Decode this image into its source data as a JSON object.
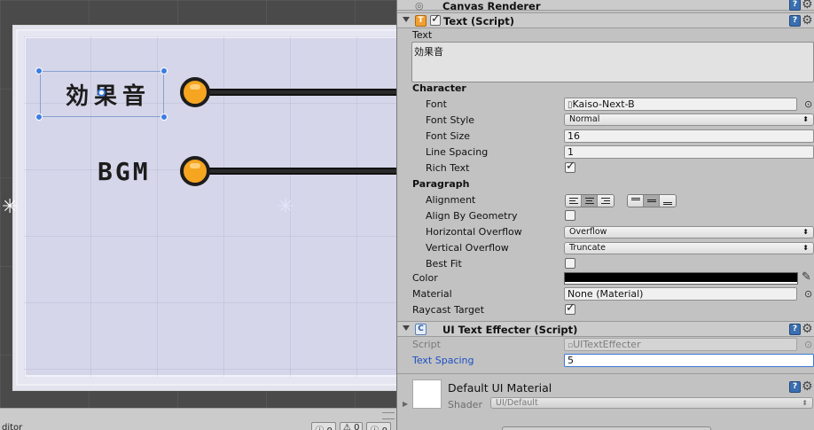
{
  "scene": {
    "label_effects": "効果音",
    "label_bgm": "BGM",
    "bottom_left_label": "ditor",
    "counter_a": "0",
    "counter_b": "0",
    "counter_c": "0"
  },
  "inspector": {
    "canvas_renderer_title": "Canvas Renderer",
    "text_component": {
      "title": "Text (Script)",
      "text_label": "Text",
      "text_value": "効果音",
      "character_heading": "Character",
      "font_label": "Font",
      "font_value": "Kaiso-Next-B",
      "font_style_label": "Font Style",
      "font_style_value": "Normal",
      "font_size_label": "Font Size",
      "font_size_value": "16",
      "line_spacing_label": "Line Spacing",
      "line_spacing_value": "1",
      "rich_text_label": "Rich Text",
      "rich_text_checked": true,
      "paragraph_heading": "Paragraph",
      "alignment_label": "Alignment",
      "align_by_geometry_label": "Align By Geometry",
      "horizontal_overflow_label": "Horizontal Overflow",
      "horizontal_overflow_value": "Overflow",
      "vertical_overflow_label": "Vertical Overflow",
      "vertical_overflow_value": "Truncate",
      "best_fit_label": "Best Fit",
      "color_label": "Color",
      "color_value": "#000000",
      "material_label": "Material",
      "material_value": "None (Material)",
      "raycast_target_label": "Raycast Target",
      "raycast_target_checked": true
    },
    "effecter_component": {
      "title": "UI Text Effecter (Script)",
      "script_label": "Script",
      "script_value": "UITextEffecter",
      "text_spacing_label": "Text Spacing",
      "text_spacing_value": "5"
    },
    "material_preview": {
      "title": "Default UI Material",
      "shader_label": "Shader",
      "shader_value": "UI/Default"
    }
  },
  "colors": {
    "accent_blue": "#3a78d8",
    "slider_knob": "#f5a520",
    "panel_bg": "#d6d6ea"
  }
}
